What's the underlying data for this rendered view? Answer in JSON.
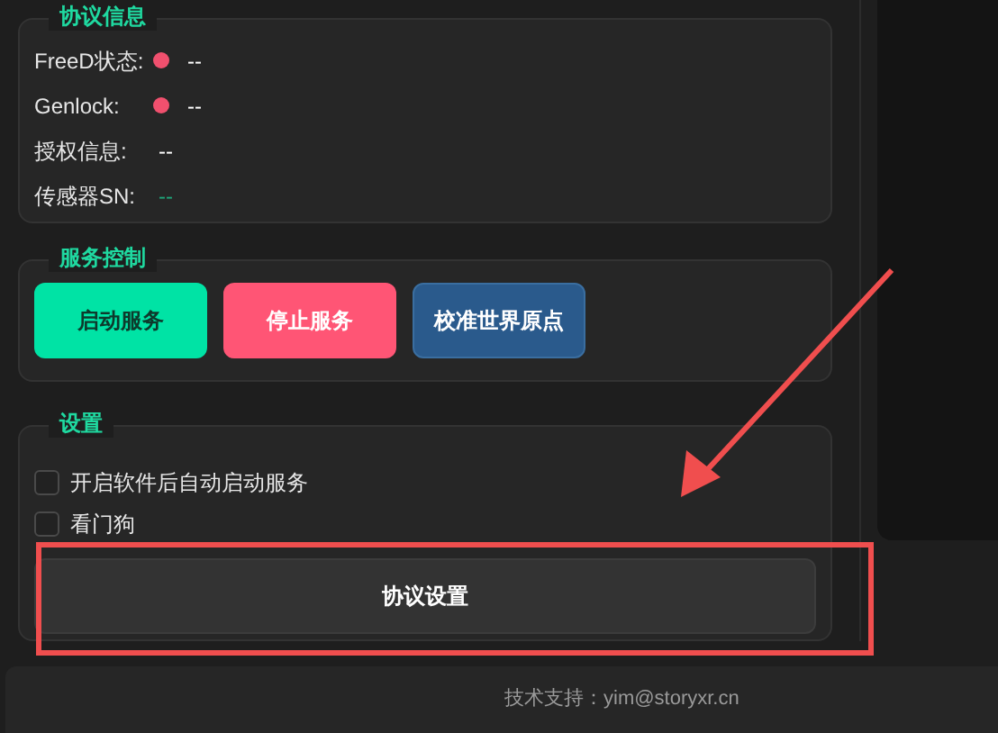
{
  "protocol_info": {
    "title": "协议信息",
    "rows": [
      {
        "label": "FreeD状态:",
        "value": "--",
        "kind": "status",
        "color": "#f0506e"
      },
      {
        "label": "Genlock:",
        "value": "--",
        "kind": "status",
        "color": "#f0506e"
      },
      {
        "label": "授权信息:",
        "value": "--",
        "kind": "text"
      },
      {
        "label": "传感器SN:",
        "value": "--",
        "kind": "accent"
      }
    ]
  },
  "service_control": {
    "title": "服务控制",
    "buttons": [
      {
        "label": "启动服务",
        "kind": "start"
      },
      {
        "label": "停止服务",
        "kind": "stop"
      },
      {
        "label": "校准世界原点",
        "kind": "calibrate"
      }
    ]
  },
  "settings": {
    "title": "设置",
    "options": [
      {
        "label": "开启软件后自动启动服务",
        "checked": false
      },
      {
        "label": "看门狗",
        "checked": false
      }
    ],
    "button": "协议设置"
  },
  "footer": "技术支持：yim@storyxr.cn"
}
